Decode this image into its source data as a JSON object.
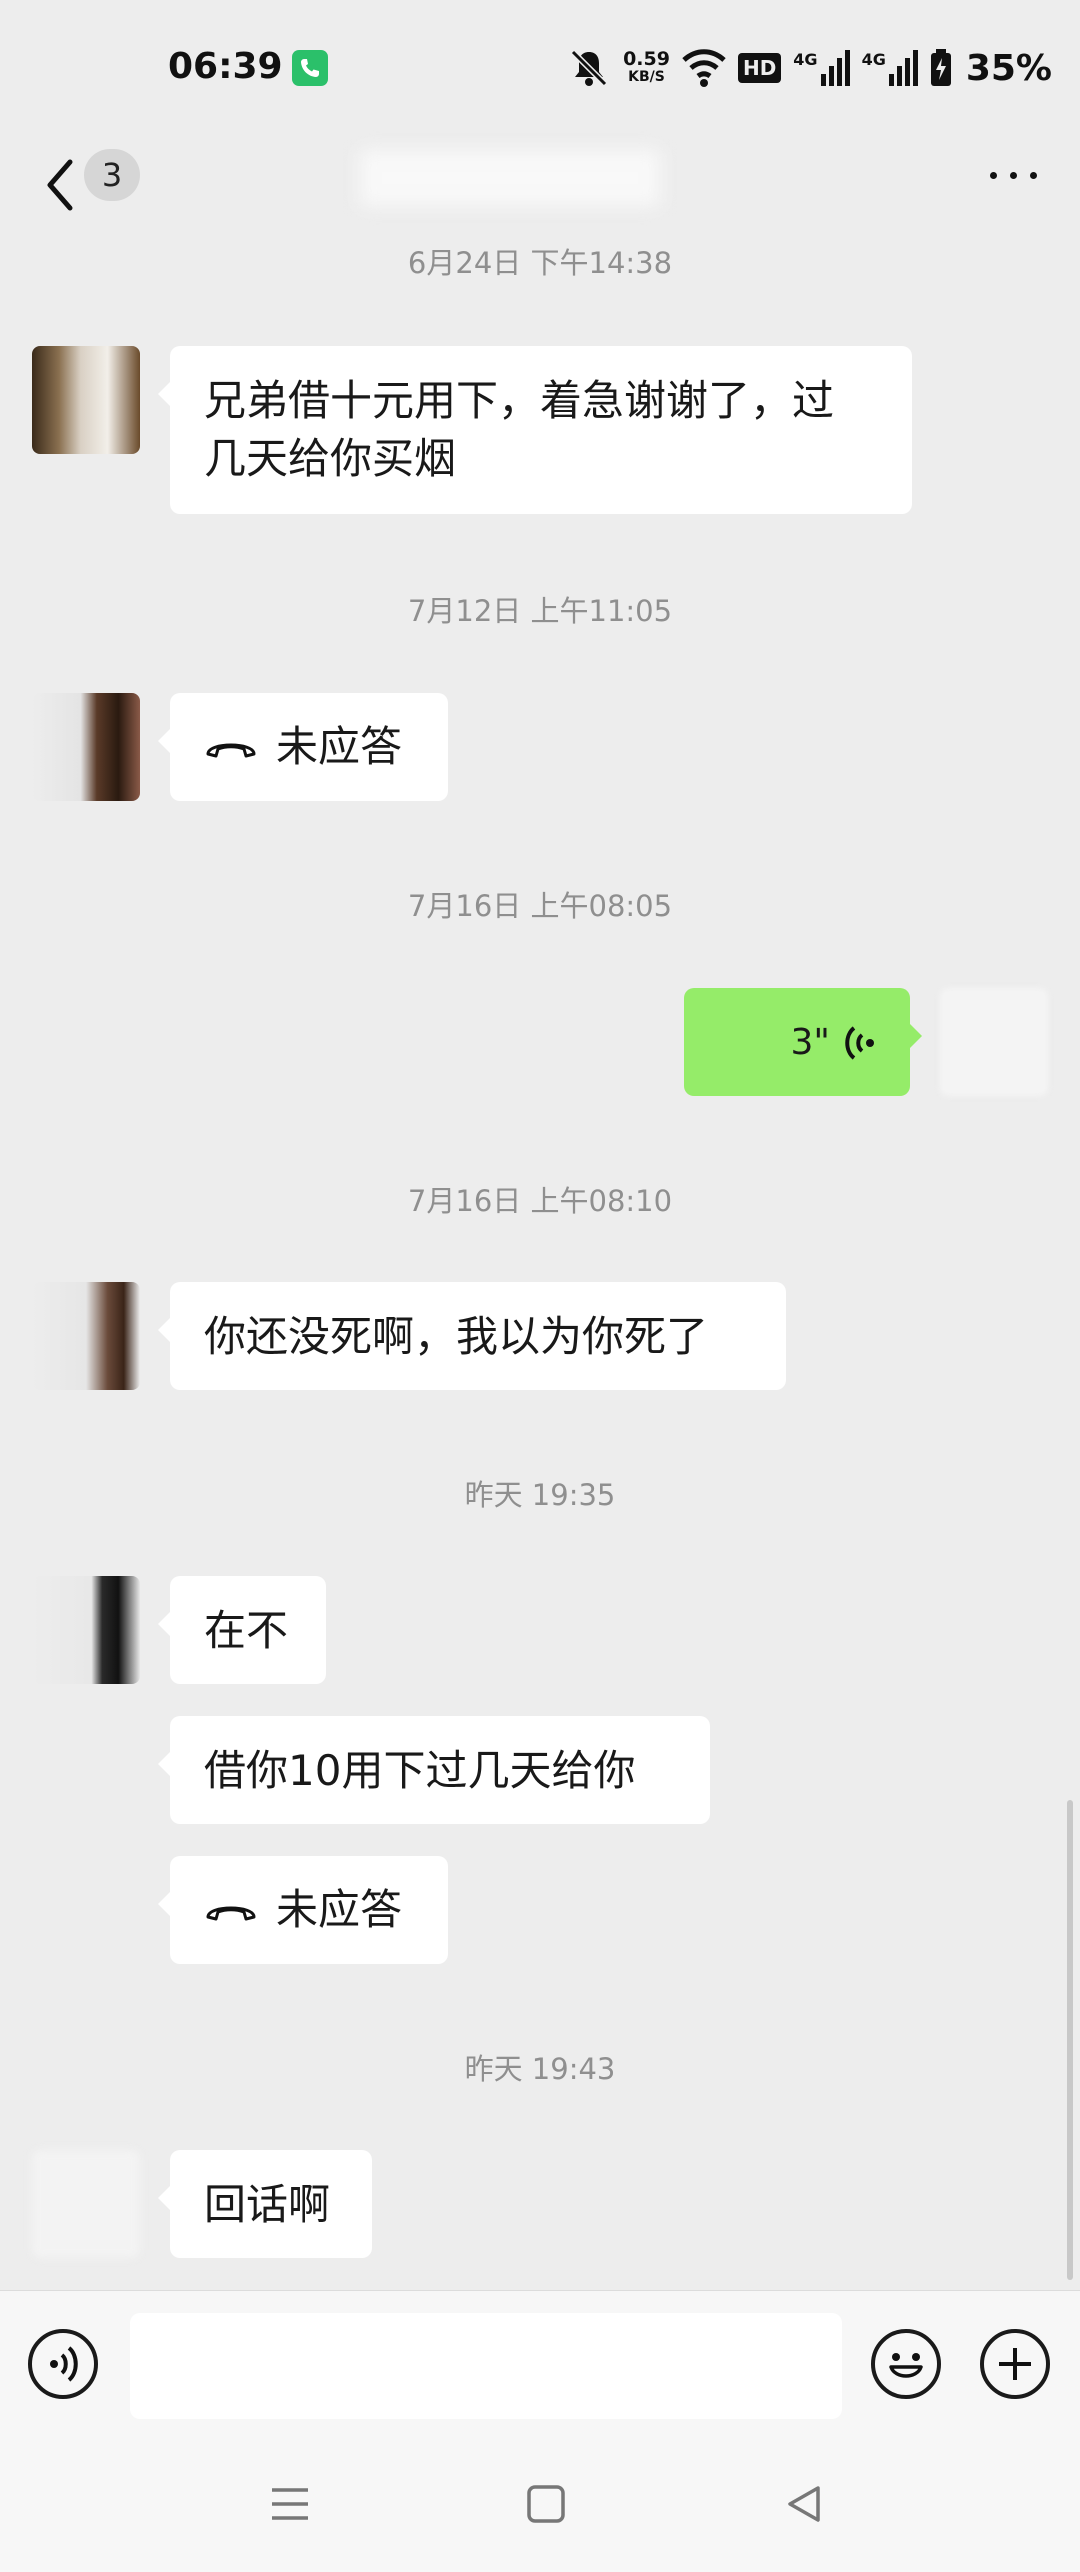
{
  "status_bar": {
    "time": "06:39",
    "net_speed_value": "0.59",
    "net_speed_unit": "KB/S",
    "hd_label": "HD",
    "signal1_label": "4G",
    "signal2_label": "4G",
    "battery_percent": "35%"
  },
  "nav": {
    "unread_count": "3"
  },
  "messages": [
    {
      "timestamp": "6月24日 下午14:38"
    },
    {
      "text_line1": "兄弟借十元用下，着急谢谢了，过",
      "text_line2": "几天给你买烟"
    },
    {
      "timestamp": "7月12日 上午11:05"
    },
    {
      "missed_label": "未应答"
    },
    {
      "timestamp": "7月16日 上午08:05"
    },
    {
      "voice_duration": "3\""
    },
    {
      "timestamp": "7月16日 上午08:10"
    },
    {
      "text": "你还没死啊，我以为你死了"
    },
    {
      "timestamp": "昨天 19:35"
    },
    {
      "text": "在不"
    },
    {
      "text": "借你10用下过几天给你"
    },
    {
      "missed_label": "未应答"
    },
    {
      "timestamp": "昨天 19:43"
    },
    {
      "text": "回话啊"
    }
  ],
  "input": {
    "value": "",
    "placeholder": ""
  },
  "colors": {
    "background": "#ededed",
    "my_bubble": "#95ec69",
    "their_bubble": "#ffffff",
    "timestamp_text": "#8f8f8f",
    "call_icon": "#2bc06a"
  },
  "icons": {
    "back": "chevron-left-icon",
    "more": "more-dots-icon",
    "voice_toggle": "voice-icon",
    "emoji": "emoji-icon",
    "plus": "plus-icon",
    "missed_call": "phone-hangup-icon",
    "voice_wave": "voice-wave-icon"
  }
}
